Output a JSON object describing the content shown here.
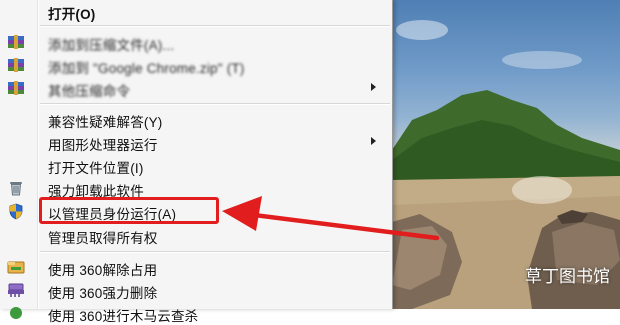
{
  "menu": {
    "items": [
      {
        "label": "打开(O)",
        "bold": true,
        "blur": false,
        "icon": "",
        "submenu": false
      },
      {
        "label": "添加到压缩文件(A)...",
        "bold": false,
        "blur": true,
        "icon": "winrar-archive-icon",
        "submenu": false
      },
      {
        "label": "添加到 \"Google Chrome.zip\" (T)",
        "bold": false,
        "blur": true,
        "icon": "winrar-archive-icon",
        "submenu": false
      },
      {
        "label": "其他压缩命令",
        "bold": false,
        "blur": true,
        "icon": "winrar-archive-icon",
        "submenu": true
      },
      {
        "label": "兼容性疑难解答(Y)",
        "bold": false,
        "blur": false,
        "icon": "",
        "submenu": false
      },
      {
        "label": "用图形处理器运行",
        "bold": false,
        "blur": false,
        "icon": "",
        "submenu": true
      },
      {
        "label": "打开文件位置(I)",
        "bold": false,
        "blur": false,
        "icon": "",
        "submenu": false
      },
      {
        "label": "强力卸载此软件",
        "bold": false,
        "blur": false,
        "icon": "recycle-bin-icon",
        "submenu": false
      },
      {
        "label": "以管理员身份运行(A)",
        "bold": false,
        "blur": false,
        "icon": "uac-shield-icon",
        "submenu": false
      },
      {
        "label": "管理员取得所有权",
        "bold": false,
        "blur": false,
        "icon": "",
        "submenu": false
      },
      {
        "label": "使用 360解除占用",
        "bold": false,
        "blur": false,
        "icon": "360-unlock-icon",
        "submenu": false
      },
      {
        "label": "使用 360强力删除",
        "bold": false,
        "blur": false,
        "icon": "360-shred-icon",
        "submenu": false
      },
      {
        "label": "使用 360进行木马云查杀",
        "bold": false,
        "blur": false,
        "icon": "360-scan-icon",
        "submenu": false
      }
    ],
    "highlighted_item": "以管理员身份运行(A)"
  },
  "annotation": {
    "color": "#e11d1d"
  },
  "watermark": {
    "text": "草丁图书馆"
  },
  "colors": {
    "menu_bg": "#f5f5f5",
    "accent_red": "#e11d1d"
  }
}
